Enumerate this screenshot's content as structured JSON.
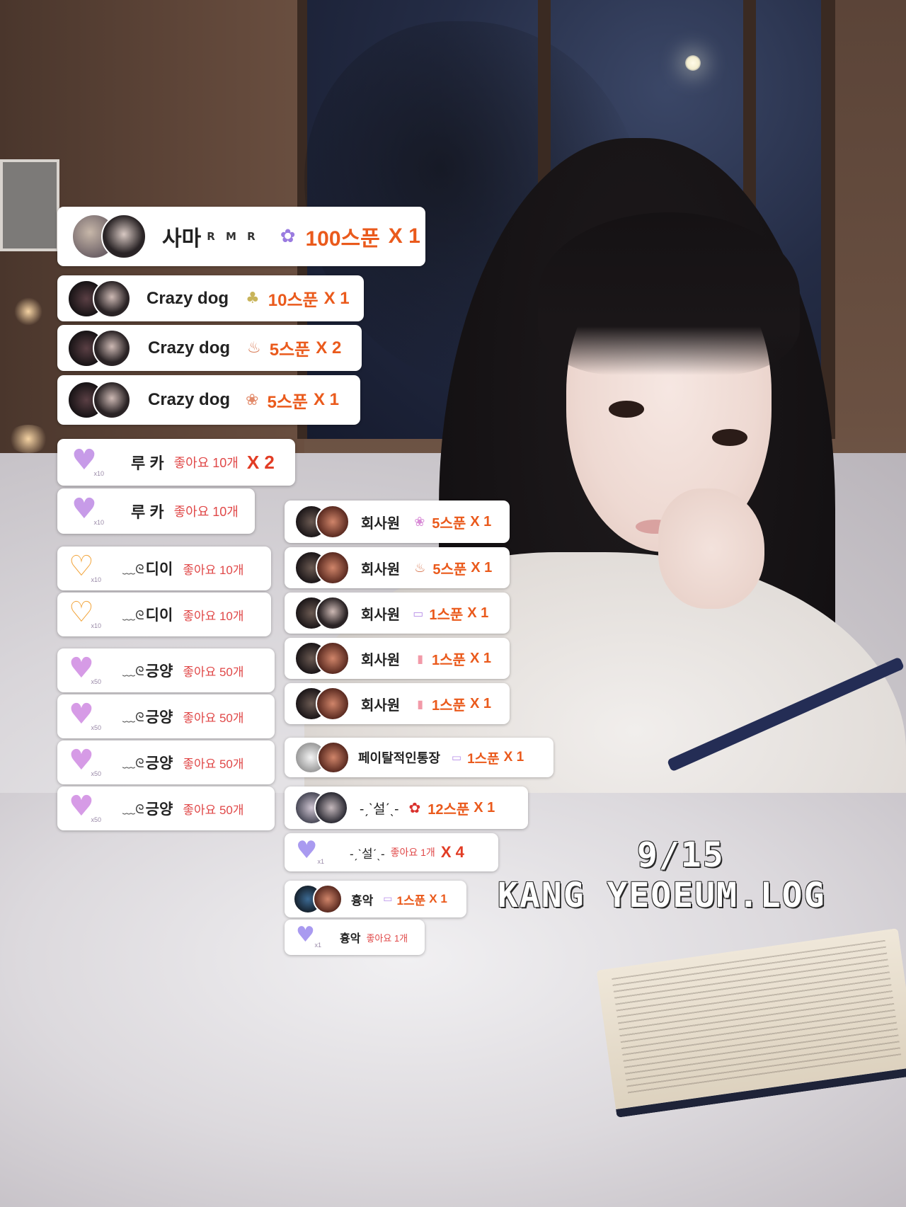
{
  "colors": {
    "amount": "#ea5a1c",
    "likes": "#e04848",
    "multiplier": "#e23c24",
    "card_bg": "#ffffff"
  },
  "donations": [
    {
      "name": "사마",
      "badge": "R M R",
      "gift_icon": "teddy-bear-icon",
      "amount": "100스푼",
      "mult": "X 1"
    },
    {
      "name": "Crazy dog",
      "gift_icon": "bunny-icon",
      "amount": "10스푼",
      "mult": "X 1"
    },
    {
      "name": "Crazy dog",
      "gift_icon": "ice-cream-icon",
      "amount": "5스푼",
      "mult": "X 2"
    },
    {
      "name": "Crazy dog",
      "gift_icon": "bunny-flower-icon",
      "amount": "5스푼",
      "mult": "X 1"
    }
  ],
  "likes_left": [
    {
      "name": "루 카",
      "heart_icon": "purple-heart-icon",
      "likes": "좋아요 10개",
      "mult": "X 2",
      "heart_sub": "x10"
    },
    {
      "name": "루 카",
      "heart_icon": "purple-heart-icon",
      "likes": "좋아요 10개",
      "heart_sub": "x10"
    },
    {
      "name": "디이",
      "prefix": "﹏ᘓ",
      "heart_icon": "gold-heart-icon",
      "likes": "좋아요 10개",
      "heart_sub": "x10"
    },
    {
      "name": "디이",
      "prefix": "﹏ᘓ",
      "heart_icon": "gold-heart-icon",
      "likes": "좋아요 10개",
      "heart_sub": "x10"
    },
    {
      "name": "긍양",
      "prefix": "﹏ᘓ",
      "heart_icon": "crystal-heart-icon",
      "likes": "좋아요 50개",
      "heart_sub": "x50"
    },
    {
      "name": "긍양",
      "prefix": "﹏ᘓ",
      "heart_icon": "crystal-heart-icon",
      "likes": "좋아요 50개",
      "heart_sub": "x50"
    },
    {
      "name": "긍양",
      "prefix": "﹏ᘓ",
      "heart_icon": "crystal-heart-icon",
      "likes": "좋아요 50개",
      "heart_sub": "x50"
    },
    {
      "name": "긍양",
      "prefix": "﹏ᘓ",
      "heart_icon": "crystal-heart-icon",
      "likes": "좋아요 50개",
      "heart_sub": "x50"
    }
  ],
  "right_items": [
    {
      "name": "회사원",
      "gift_icon": "flower-bouquet-icon",
      "amount": "5스푼",
      "mult": "X 1"
    },
    {
      "name": "회사원",
      "gift_icon": "ice-cream-icon",
      "amount": "5스푼",
      "mult": "X 1"
    },
    {
      "name": "회사원",
      "gift_icon": "ticket-icon",
      "amount": "1스푼",
      "mult": "X 1"
    },
    {
      "name": "회사원",
      "gift_icon": "popsicle-icon",
      "amount": "1스푼",
      "mult": "X 1"
    },
    {
      "name": "회사원",
      "gift_icon": "popsicle-icon",
      "amount": "1스푼",
      "mult": "X 1"
    },
    {
      "name": "페이탈적인통장",
      "gift_icon": "ticket-icon",
      "amount": "1스푼",
      "mult": "X 1"
    },
    {
      "name": "-ˏˋ설ˊˎ-",
      "gift_icon": "rose-icon",
      "amount": "12스푼",
      "mult": "X 1"
    },
    {
      "name": "-ˏˋ설ˊˎ-",
      "heart_icon": "lilac-hearts-icon",
      "likes": "좋아요 1개",
      "mult": "X 4",
      "heart_sub": "x1"
    },
    {
      "name": "흉악",
      "gift_icon": "ticket-icon",
      "amount": "1스푼",
      "mult": "X 1"
    },
    {
      "name": "흉악",
      "heart_icon": "lilac-hearts-icon",
      "likes": "좋아요 1개",
      "heart_sub": "x1"
    }
  ],
  "caption": {
    "date": "9/15",
    "title": "KANG YEOEUM.LOG"
  }
}
